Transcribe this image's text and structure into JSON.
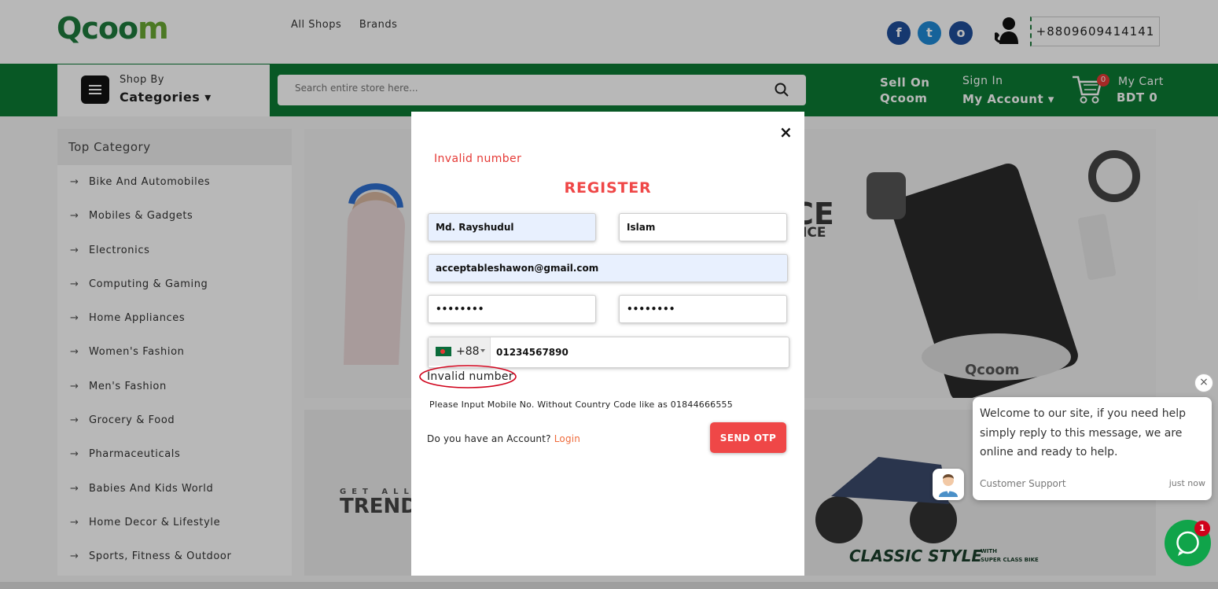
{
  "header": {
    "logo": {
      "q": "Q",
      "rest": "coo",
      "m": "m"
    },
    "nav": [
      "All Shops",
      "Brands"
    ],
    "social": [
      "f",
      "t",
      "o"
    ],
    "phone": "+8809609414141"
  },
  "greenbar": {
    "shop_by": "Shop By",
    "categories": "Categories",
    "search_placeholder": "Search entire store here...",
    "sell_on": "Sell On",
    "sell_brand": "Qcoom",
    "sign_in": "Sign In",
    "my_account": "My Account",
    "cart_count": "0",
    "my_cart": "My Cart",
    "cart_total": "BDT 0"
  },
  "sidebar": {
    "heading": "Top Category",
    "items": [
      "Bike And Automobiles",
      "Mobiles & Gadgets",
      "Electronics",
      "Computing & Gaming",
      "Home Appliances",
      "Women's Fashion",
      "Men's Fashion",
      "Grocery & Food",
      "Pharmaceuticals",
      "Babies And Kids World",
      "Home Decor & Lifestyle",
      "Sports, Fitness & Outdoor"
    ]
  },
  "banners": {
    "b1_text1": "CE",
    "b1_text2": "RICE",
    "b1_brand": "Qcoom",
    "b2_get": "GET ALL",
    "b2_trend": "TRENDI",
    "b2_classic": "CLASSIC STYLE",
    "b2_with": "WITH",
    "b2_super": "SUPER CLASS BIKE"
  },
  "modal": {
    "close": "×",
    "error_top": "Invalid number",
    "title": "REGISTER",
    "first_name": "Md. Rayshudul",
    "last_name": "Islam",
    "email": "acceptableshawon@gmail.com",
    "password": "••••••••",
    "confirm_password": "••••••••",
    "country_code": "+88",
    "phone": "01234567890",
    "error_under": "Invalid number",
    "hint": "Please Input Mobile No. Without Country Code like as 01844666555",
    "account_question": "Do you have an Account?",
    "login_link": "Login",
    "send_otp": "SEND OTP"
  },
  "chat": {
    "close": "×",
    "message": "Welcome to our site, if you need help simply reply to this message, we are online and ready to help.",
    "agent": "Customer Support",
    "time": "just now",
    "badge": "1"
  }
}
